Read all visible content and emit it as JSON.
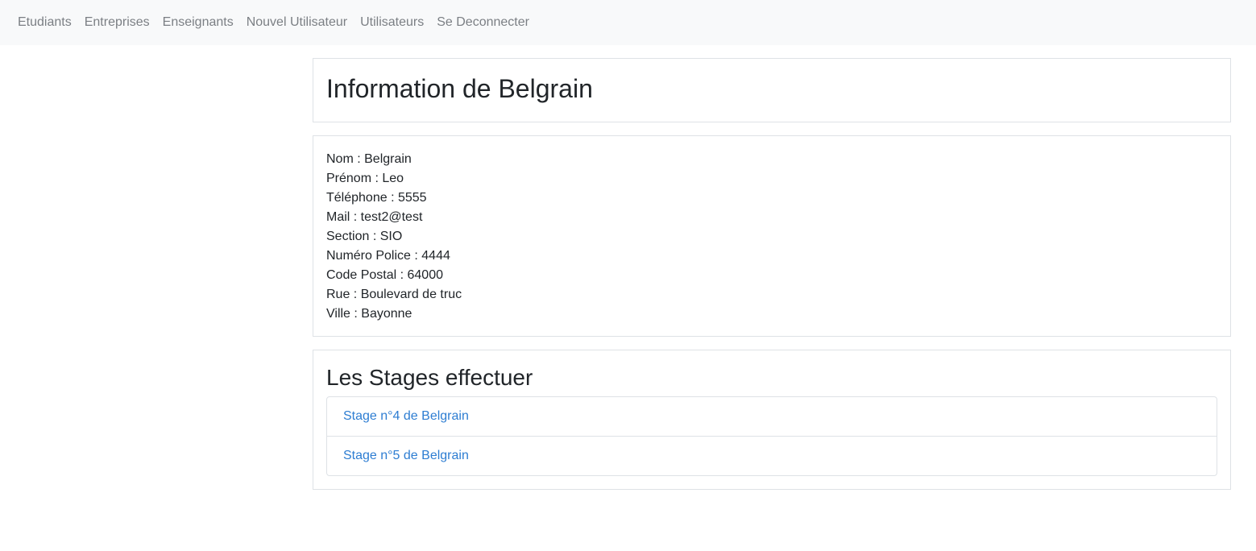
{
  "nav": {
    "items": [
      "Etudiants",
      "Entreprises",
      "Enseignants",
      "Nouvel Utilisateur",
      "Utilisateurs",
      "Se Deconnecter"
    ]
  },
  "page": {
    "title": "Information de Belgrain"
  },
  "info": {
    "lines": [
      "Nom : Belgrain",
      "Prénom : Leo",
      "Téléphone : 5555",
      "Mail : test2@test",
      "Section : SIO",
      "Numéro Police : 4444",
      "Code Postal : 64000",
      "Rue : Boulevard de truc",
      "Ville : Bayonne"
    ]
  },
  "stages": {
    "heading": "Les Stages effectuer",
    "items": [
      "Stage n°4 de Belgrain",
      "Stage n°5 de Belgrain"
    ]
  },
  "colors": {
    "navbar_bg": "#f8f9fa",
    "nav_link": "#7b7f84",
    "link": "#2d7dd2",
    "border": "#dee2e6",
    "text": "#212529"
  }
}
